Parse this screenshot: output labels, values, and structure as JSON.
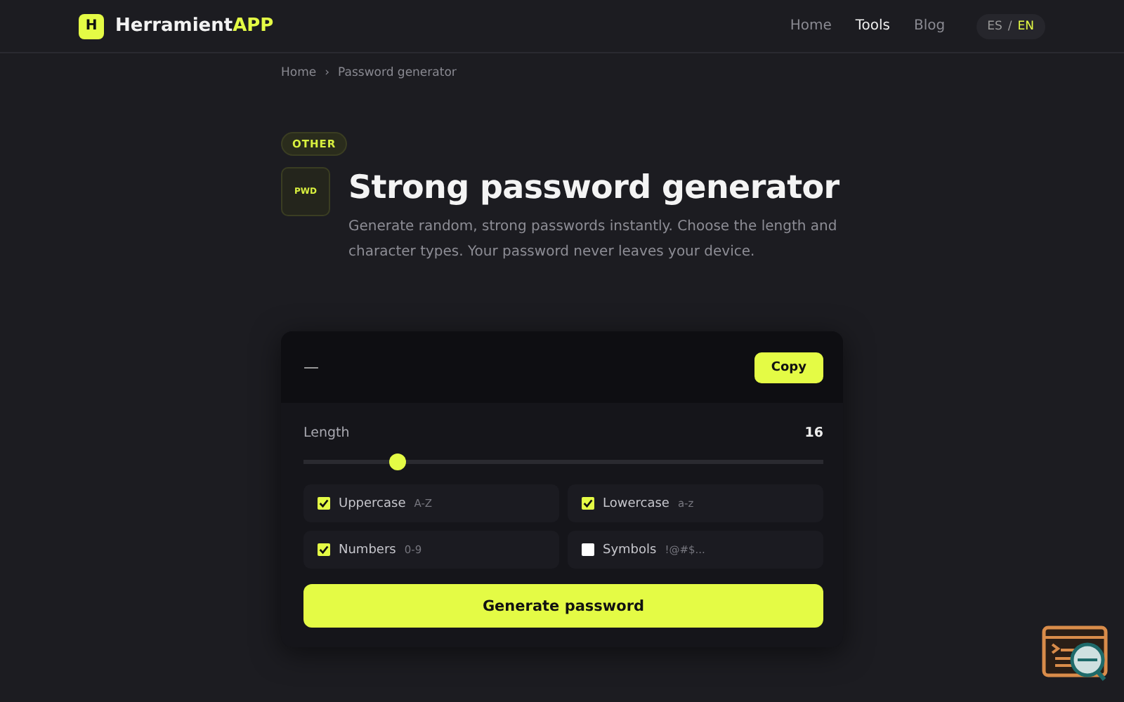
{
  "header": {
    "logo_letter": "H",
    "brand": "Herramient",
    "brand_accent": "APP",
    "nav": [
      {
        "label": "Home",
        "selected": false
      },
      {
        "label": "Tools",
        "selected": true
      },
      {
        "label": "Blog",
        "selected": false
      }
    ],
    "languages": [
      {
        "label": "ES",
        "selected": false
      },
      {
        "label": "EN",
        "selected": true
      }
    ],
    "language_separator": "/"
  },
  "breadcrumb": {
    "items": [
      "Home",
      "Password generator"
    ],
    "separator": "›"
  },
  "category_badge": "OTHER",
  "tool_icon_text": "PWD",
  "title": "Strong password generator",
  "description": "Generate random, strong passwords instantly. Choose the length and character types. Your password never leaves your device.",
  "generator": {
    "password": "—",
    "copy_button": "Copy",
    "length_label": "Length",
    "length_value": "16",
    "length_slider": {
      "level": 0.18
    },
    "options": [
      {
        "label": "Uppercase",
        "hint": "A-Z",
        "checked": true
      },
      {
        "label": "Lowercase",
        "hint": "a-z",
        "checked": true
      },
      {
        "label": "Numbers",
        "hint": "0-9",
        "checked": true
      },
      {
        "label": "Symbols",
        "hint": "!@#$...",
        "checked": false
      }
    ],
    "generate_button": "Generate password"
  }
}
